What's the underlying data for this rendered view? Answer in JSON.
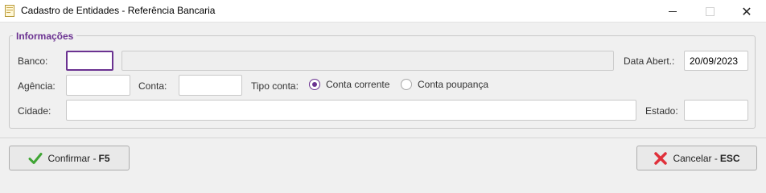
{
  "window": {
    "title": "Cadastro de Entidades - Referência Bancaria"
  },
  "group": {
    "legend": "Informações"
  },
  "fields": {
    "banco_label": "Banco:",
    "banco_code": "",
    "banco_name": "",
    "data_abert_label": "Data Abert.:",
    "data_abert_value": "20/09/2023",
    "agencia_label": "Agência:",
    "agencia_value": "",
    "conta_label": "Conta:",
    "conta_value": "",
    "tipo_conta_label": "Tipo conta:",
    "cidade_label": "Cidade:",
    "cidade_value": "",
    "estado_label": "Estado:",
    "estado_value": ""
  },
  "tipo_conta": {
    "options": [
      {
        "label": "Conta corrente",
        "checked": true
      },
      {
        "label": "Conta poupança",
        "checked": false
      }
    ]
  },
  "buttons": {
    "confirm_label": "Confirmar -",
    "confirm_key": "F5",
    "cancel_label": "Cancelar -",
    "cancel_key": "ESC"
  },
  "icons": {
    "app": "document-icon",
    "confirm": "checkmark-icon",
    "cancel": "red-x-icon"
  },
  "colors": {
    "accent": "#6b3291",
    "confirm_icon": "#3fa534",
    "cancel_icon": "#e0303a"
  }
}
